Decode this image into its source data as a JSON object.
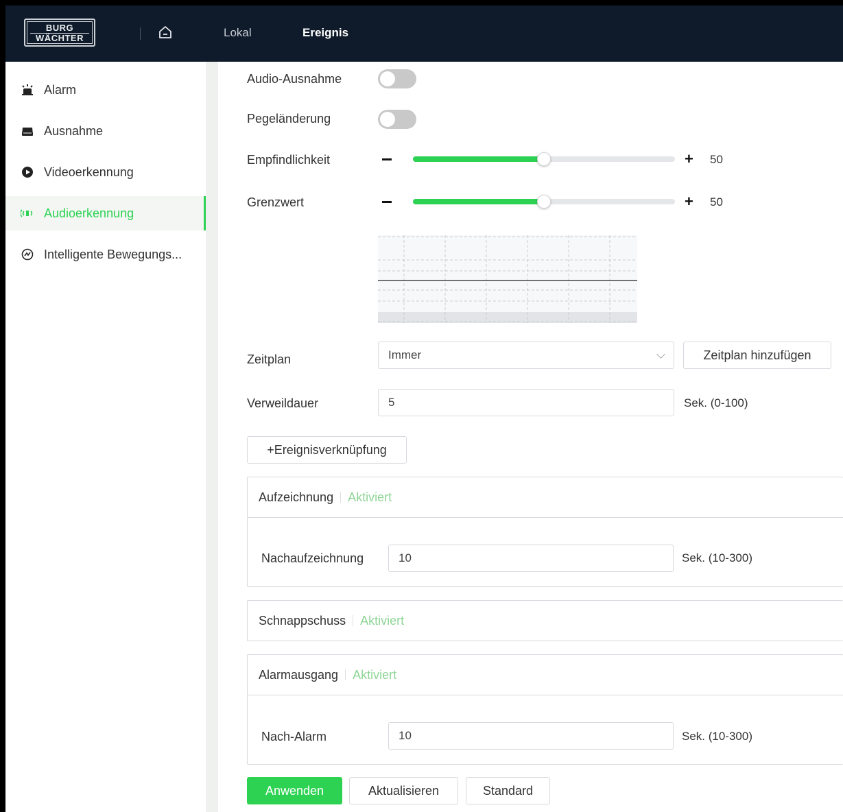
{
  "topbar": {
    "logo_line1": "BURG",
    "logo_line2": "WÄCHTER",
    "tabs": [
      {
        "label": "Lokal",
        "active": false
      },
      {
        "label": "Ereignis",
        "active": true
      }
    ]
  },
  "sidebar": {
    "items": [
      {
        "label": "Alarm",
        "icon": "siren-icon"
      },
      {
        "label": "Ausnahme",
        "icon": "exception-icon"
      },
      {
        "label": "Videoerkennung",
        "icon": "video-detect-icon"
      },
      {
        "label": "Audioerkennung",
        "icon": "audio-detect-icon",
        "active": true
      },
      {
        "label": "Intelligente Bewegungs...",
        "icon": "smart-motion-icon"
      }
    ]
  },
  "main": {
    "audio_exception": {
      "label": "Audio-Ausnahme",
      "enabled": false
    },
    "level_change": {
      "label": "Pegeländerung",
      "enabled": false
    },
    "sensitivity": {
      "label": "Empfindlichkeit",
      "value": "50",
      "fraction": 0.5
    },
    "threshold": {
      "label": "Grenzwert",
      "value": "50",
      "fraction": 0.5
    },
    "schedule": {
      "label": "Zeitplan",
      "value": "Immer",
      "add_button": "Zeitplan hinzufügen"
    },
    "dwell": {
      "label": "Verweildauer",
      "value": "5",
      "unit": "Sek. (0-100)"
    },
    "event_link_button": "+Ereignisverknüpfung",
    "recording": {
      "title": "Aufzeichnung",
      "status": "Aktiviert",
      "field_label": "Nachaufzeichnung",
      "value": "10",
      "unit": "Sek. (10-300)"
    },
    "snapshot": {
      "title": "Schnappschuss",
      "status": "Aktiviert"
    },
    "alarm_out": {
      "title": "Alarmausgang",
      "status": "Aktiviert",
      "field_label": "Nach-Alarm",
      "value": "10",
      "unit": "Sek. (10-300)"
    },
    "buttons": {
      "apply": "Anwenden",
      "refresh": "Aktualisieren",
      "default": "Standard"
    }
  },
  "colors": {
    "accent": "#2ed253",
    "topbar": "#0f1b2a",
    "status": "#8fd596"
  }
}
